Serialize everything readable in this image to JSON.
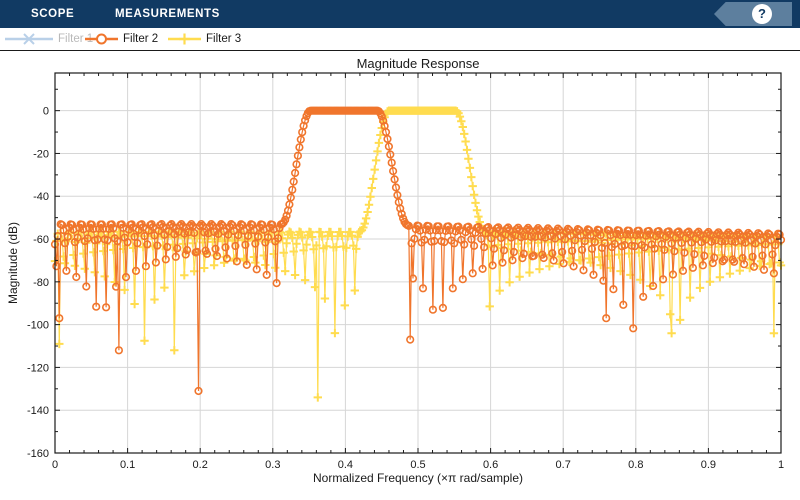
{
  "toolbar": {
    "bg": "#113a63",
    "tabs": [
      {
        "label": "SCOPE"
      },
      {
        "label": "MEASUREMENTS"
      }
    ],
    "help": {
      "glyph": "?",
      "shape_color": "#5d7f9e"
    }
  },
  "legend": {
    "items": [
      {
        "label": "Filter 1",
        "marker": "x",
        "line_color": "#b9d0e8",
        "label_color": "#b9b9b9",
        "enabled": false
      },
      {
        "label": "Filter 2",
        "marker": "o",
        "line_color": "#f0752c",
        "label_color": "#1a1a1a",
        "enabled": true
      },
      {
        "label": "Filter 3",
        "marker": "plus",
        "line_color": "#ffdc4f",
        "label_color": "#1a1a1a",
        "enabled": true
      }
    ]
  },
  "chart_data": {
    "type": "line",
    "title": "Magnitude Response",
    "xlabel": "Normalized Frequency (×π rad/sample)",
    "ylabel": "Magnitude (dB)",
    "xlim": [
      0,
      1
    ],
    "ylim": [
      -160,
      17.6
    ],
    "x_ticks": {
      "values": [
        0,
        0.1,
        0.2,
        0.3,
        0.4,
        0.5,
        0.6,
        0.7,
        0.8,
        0.9,
        1
      ],
      "labels": [
        "0",
        "0.1",
        "0.2",
        "0.3",
        "0.4",
        "0.5",
        "0.6",
        "0.7",
        "0.8",
        "0.9",
        "1"
      ]
    },
    "y_ticks": {
      "values": [
        0,
        -20,
        -40,
        -60,
        -80,
        -100,
        -120,
        -140,
        -160
      ],
      "labels": [
        "0",
        "-20",
        "-40",
        "-60",
        "-80",
        "-100",
        "-120",
        "-140",
        "-160"
      ]
    },
    "x_minor_step": 0.02,
    "y_minor_step": 10,
    "grid": true,
    "grid_color": "#d6d6d6",
    "axis_color": "#1a1a1a",
    "legend_position": "top-left-bar",
    "n_points": 512,
    "series": [
      {
        "name": "Filter 1",
        "visible": false,
        "color": "#b9d0e8",
        "marker": "x",
        "z": 0
      },
      {
        "name": "Filter 2",
        "visible": true,
        "color": "#f0752c",
        "marker": "o",
        "z": 2,
        "response": {
          "passband_db": 0,
          "stopband_left_db": -53,
          "stopband_right_db_near": -53.5,
          "stopband_right_db_far": -57.5,
          "f_stop1": 0.312,
          "f_pass1": 0.352,
          "f_pass2": 0.444,
          "f_stop2": 0.486,
          "null_spacing": 0.0138
        },
        "deep_nulls": [
          [
            0.006,
            -97
          ],
          [
            0.0875,
            -112
          ],
          [
            0.197,
            -131
          ],
          [
            0.489,
            -107
          ],
          [
            0.76,
            -97
          ]
        ]
      },
      {
        "name": "Filter 3",
        "visible": true,
        "color": "#ffdc4f",
        "marker": "plus",
        "z": 1,
        "response": {
          "passband_db": 0,
          "stopband_left_db": -56.5,
          "stopband_right_db_near": -56,
          "stopband_right_db_far": -58.5,
          "f_stop1": 0.42,
          "f_pass1": 0.46,
          "f_pass2": 0.552,
          "f_stop2": 0.592,
          "null_spacing": 0.0138
        },
        "deep_nulls": [
          [
            0.0065,
            -109
          ],
          [
            0.164,
            -112
          ],
          [
            0.362,
            -134
          ],
          [
            0.85,
            -104
          ],
          [
            0.99,
            -104
          ]
        ]
      }
    ]
  }
}
